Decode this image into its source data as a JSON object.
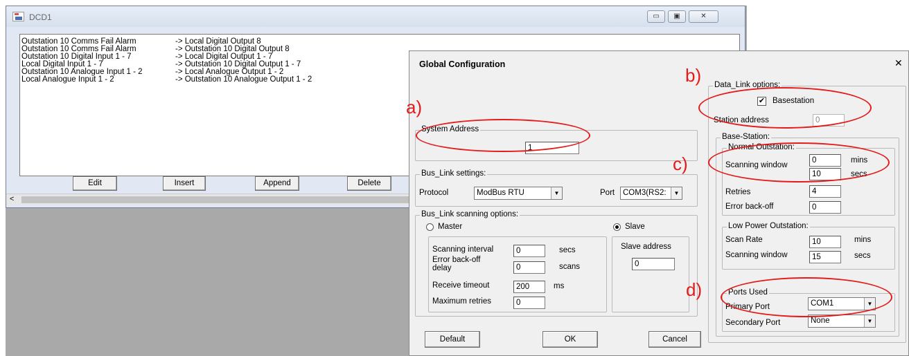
{
  "dcd_window": {
    "title": "DCD1",
    "controls": {
      "minimize": "▭",
      "maximize": "▣",
      "close": "✕"
    },
    "rows": [
      {
        "source": "Outstation 10 Comms Fail Alarm",
        "target": "-> Local Digital Output 8"
      },
      {
        "source": "Outstation 10 Comms Fail Alarm",
        "target": "-> Outstation 10 Digital Output 8"
      },
      {
        "source": "Outstation 10 Digital Input 1 - 7",
        "target": "-> Local Digital Output 1 - 7"
      },
      {
        "source": "Local Digital Input 1 - 7",
        "target": "-> Outstation 10 Digital Output 1 - 7"
      },
      {
        "source": "Outstation 10 Analogue Input 1 - 2",
        "target": "-> Local Analogue Output 1 - 2"
      },
      {
        "source": "Local Analogue Input 1 - 2",
        "target": "-> Outstation 10 Analogue Output 1 - 2"
      }
    ],
    "buttons": {
      "edit": "Edit",
      "insert": "Insert",
      "append": "Append",
      "delete": "Delete"
    },
    "scroll_left": "<"
  },
  "dialog": {
    "title": "Global Configuration",
    "close": "✕",
    "system_address": {
      "label": "System Address",
      "value": "1"
    },
    "bus_link_settings": {
      "label": "Bus_Link settings:",
      "protocol_label": "Protocol",
      "protocol_value": "ModBus RTU",
      "port_label": "Port",
      "port_value": "COM3(RS2:"
    },
    "bus_link_scanning": {
      "label": "Bus_Link scanning options:",
      "master_label": "Master",
      "slave_label": "Slave",
      "selected": "Slave",
      "scanning_interval_label": "Scanning interval",
      "scanning_interval_value": "0",
      "scanning_interval_unit": "secs",
      "error_backoff_label_1": "Error back-off",
      "error_backoff_label_2": "delay",
      "error_backoff_value": "0",
      "error_backoff_unit": "scans",
      "receive_timeout_label": "Receive timeout",
      "receive_timeout_value": "200",
      "receive_timeout_unit": "ms",
      "max_retries_label": "Maximum retries",
      "max_retries_value": "0",
      "slave_address_label": "Slave address",
      "slave_address_value": "0"
    },
    "data_link": {
      "label": "Data_Link options:",
      "basestation_label": "Basestation",
      "basestation_checked": "✔",
      "station_address_label": "Station address",
      "station_address_value": "0"
    },
    "base_station": {
      "label": "Base-Station:",
      "normal": {
        "label": "Normal Outstation:",
        "scanning_window_label": "Scanning window",
        "mins_value": "0",
        "mins_unit": "mins",
        "secs_value": "10",
        "secs_unit": "secs",
        "retries_label": "Retries",
        "retries_value": "4",
        "error_backoff_label": "Error back-off",
        "error_backoff_value": "0"
      },
      "low_power": {
        "label": "Low Power Outstation:",
        "scan_rate_label": "Scan Rate",
        "scan_rate_value": "10",
        "scan_rate_unit": "mins",
        "scanning_window_label": "Scanning window",
        "scanning_window_value": "15",
        "scanning_window_unit": "secs"
      },
      "ports": {
        "label": "Ports Used",
        "primary_label": "Primary Port",
        "primary_value": "COM1",
        "secondary_label": "Secondary Port",
        "secondary_value": "None"
      }
    },
    "buttons": {
      "default": "Default",
      "ok": "OK",
      "cancel": "Cancel"
    },
    "dropdown_arrow": "▼"
  },
  "annotations": {
    "a": "a)",
    "b": "b)",
    "c": "c)",
    "d": "d)"
  },
  "colors": {
    "annotation": "#e41b1b",
    "desktop": "#a9a9a9",
    "dialog_bg": "#f0f0f0"
  }
}
